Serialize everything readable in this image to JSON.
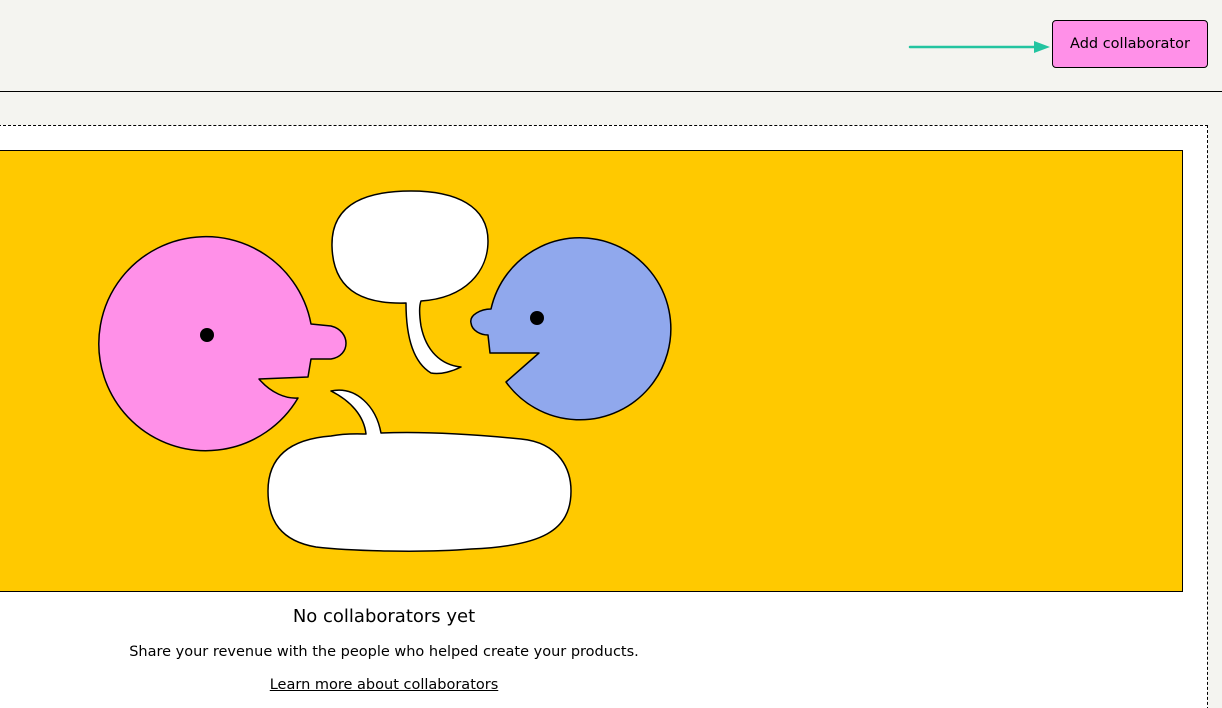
{
  "header": {
    "add_button_label": "Add collaborator"
  },
  "empty_state": {
    "title": "No collaborators yet",
    "description": "Share your revenue with the people who helped create your products.",
    "link_label": "Learn more about collaborators"
  },
  "colors": {
    "page_background": "#f4f4f0",
    "illustration_background": "#ffc900",
    "button_background": "#ff90e8",
    "annotation_arrow": "#23c4a0",
    "pink_face": "#ff90e8",
    "blue_face": "#90a8ed"
  },
  "icons": {
    "annotation": "arrow-right-icon",
    "illustration": "conversation-illustration"
  }
}
